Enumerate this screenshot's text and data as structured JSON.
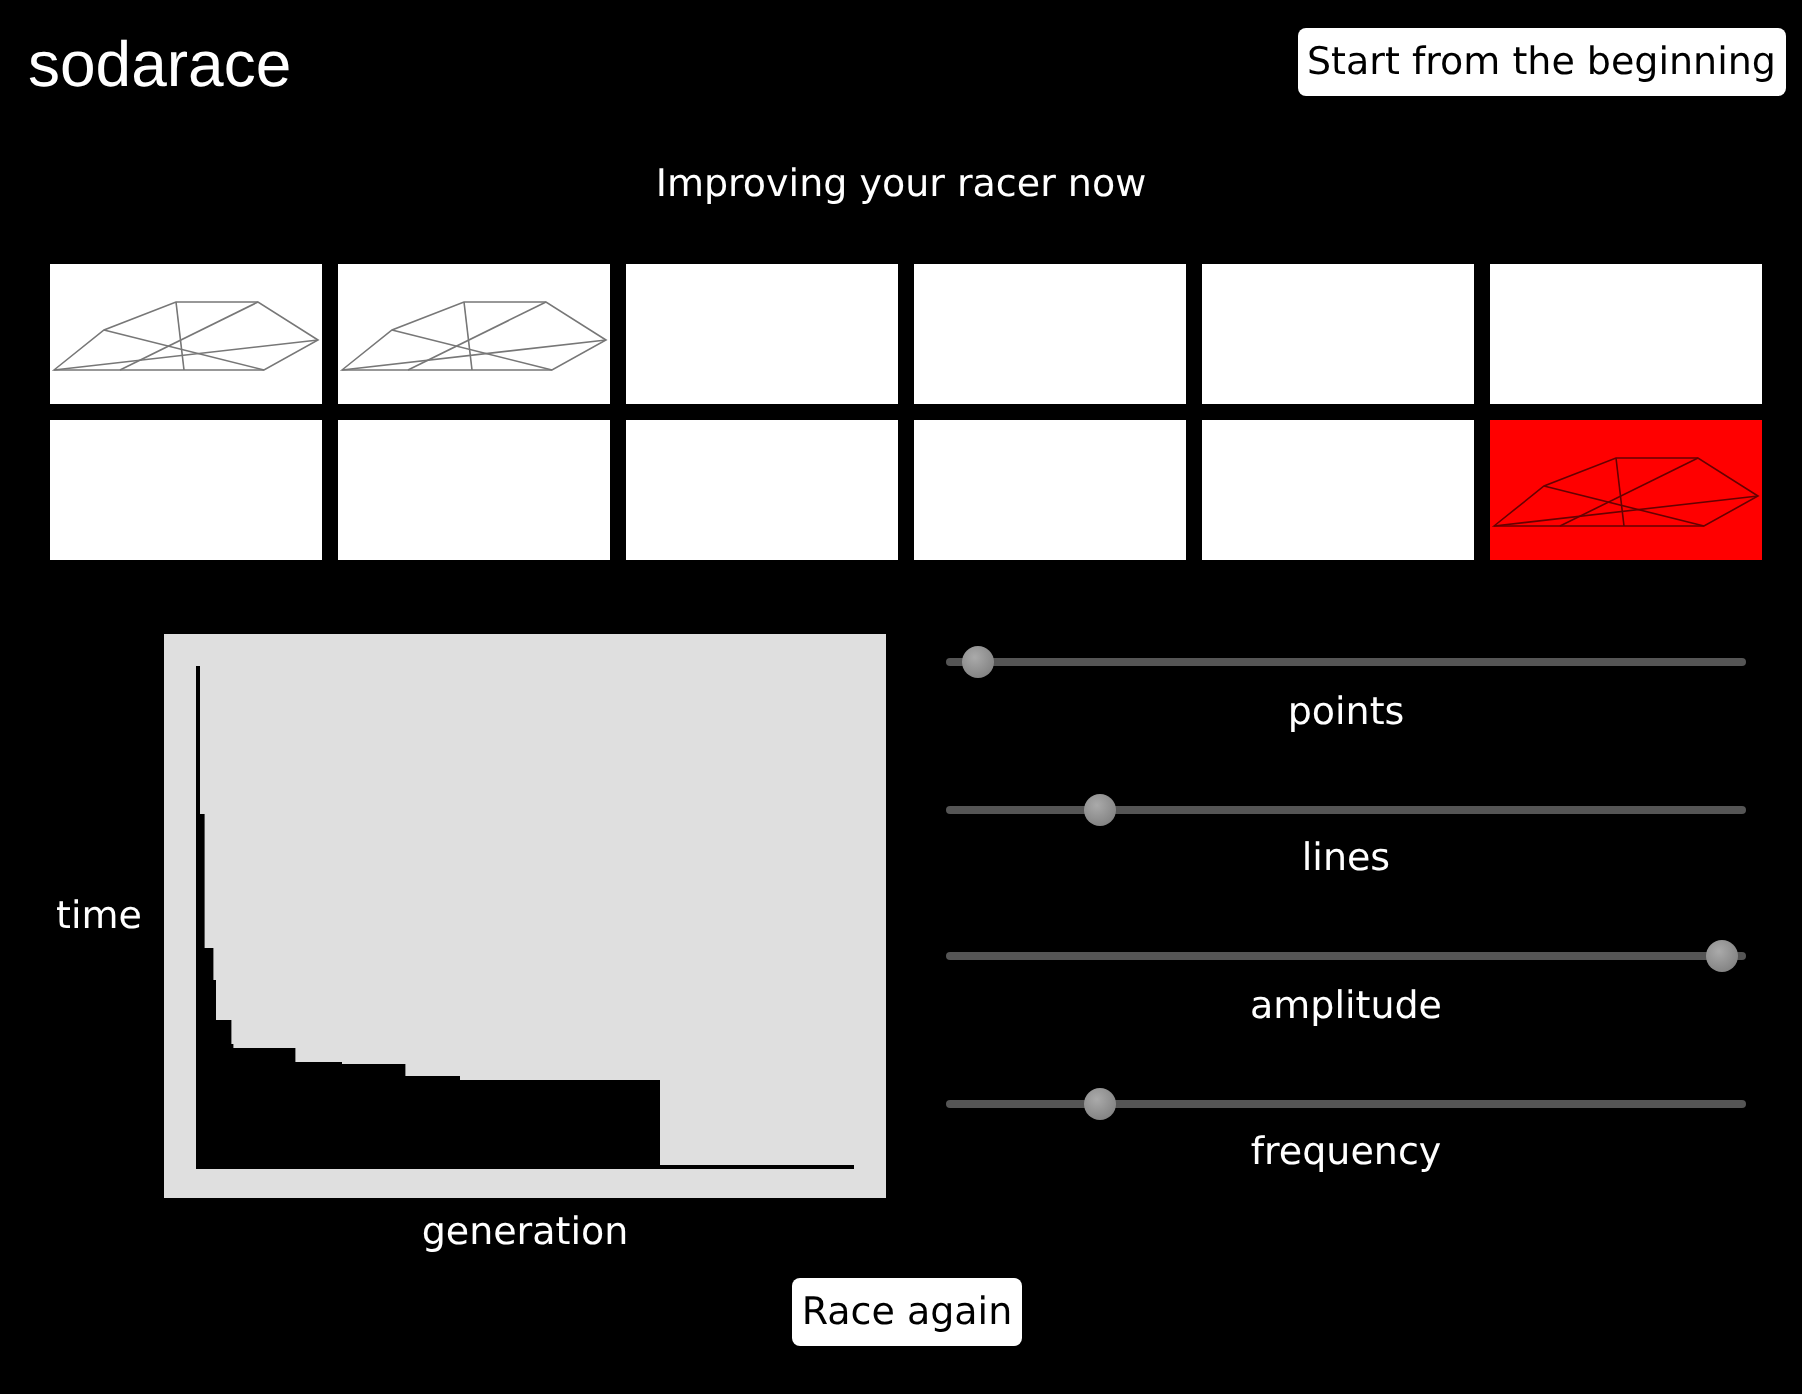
{
  "app": {
    "title": "sodarace",
    "restart_button": "Start from the beginning"
  },
  "status": "Improving your racer now",
  "racers": [
    {
      "kind": "racer",
      "selected": false
    },
    {
      "kind": "racer",
      "selected": false
    },
    {
      "kind": "empty",
      "selected": false
    },
    {
      "kind": "empty",
      "selected": false
    },
    {
      "kind": "empty",
      "selected": false
    },
    {
      "kind": "empty",
      "selected": false
    },
    {
      "kind": "empty",
      "selected": false
    },
    {
      "kind": "empty",
      "selected": false
    },
    {
      "kind": "empty",
      "selected": false
    },
    {
      "kind": "empty",
      "selected": false
    },
    {
      "kind": "empty",
      "selected": false
    },
    {
      "kind": "racer",
      "selected": true
    }
  ],
  "chart": {
    "ylabel": "time",
    "xlabel": "generation"
  },
  "sliders": [
    {
      "label": "points",
      "level": 0.02
    },
    {
      "label": "lines",
      "level": 0.18
    },
    {
      "label": "amplitude",
      "level": 0.99
    },
    {
      "label": "frequency",
      "level": 0.18
    }
  ],
  "race_button": "Race again"
}
